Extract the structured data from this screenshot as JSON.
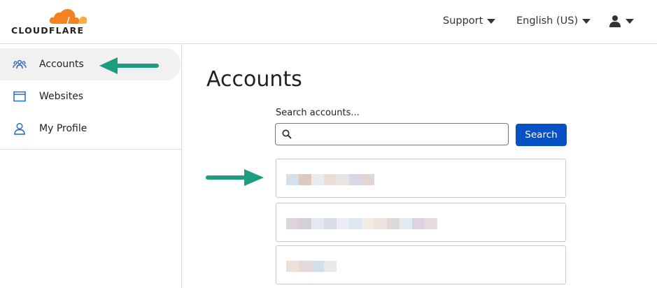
{
  "brand": {
    "name": "CLOUDFLARE",
    "cloud_color": "#f6821f",
    "cloud_light": "#fbad41"
  },
  "header": {
    "support_label": "Support",
    "language_label": "English (US)",
    "user_icon": "user-icon"
  },
  "sidebar": {
    "items": [
      {
        "label": "Accounts",
        "icon": "accounts-icon",
        "active": true
      },
      {
        "label": "Websites",
        "icon": "window-icon",
        "active": false
      },
      {
        "label": "My Profile",
        "icon": "profile-icon",
        "active": false
      }
    ]
  },
  "main": {
    "title": "Accounts",
    "search_label": "Search accounts...",
    "search_value": "",
    "search_button": "Search"
  },
  "colors": {
    "accent": "#0652c5",
    "annotation_arrow": "#1a9e7f",
    "icon_blue": "#1d63c3"
  }
}
